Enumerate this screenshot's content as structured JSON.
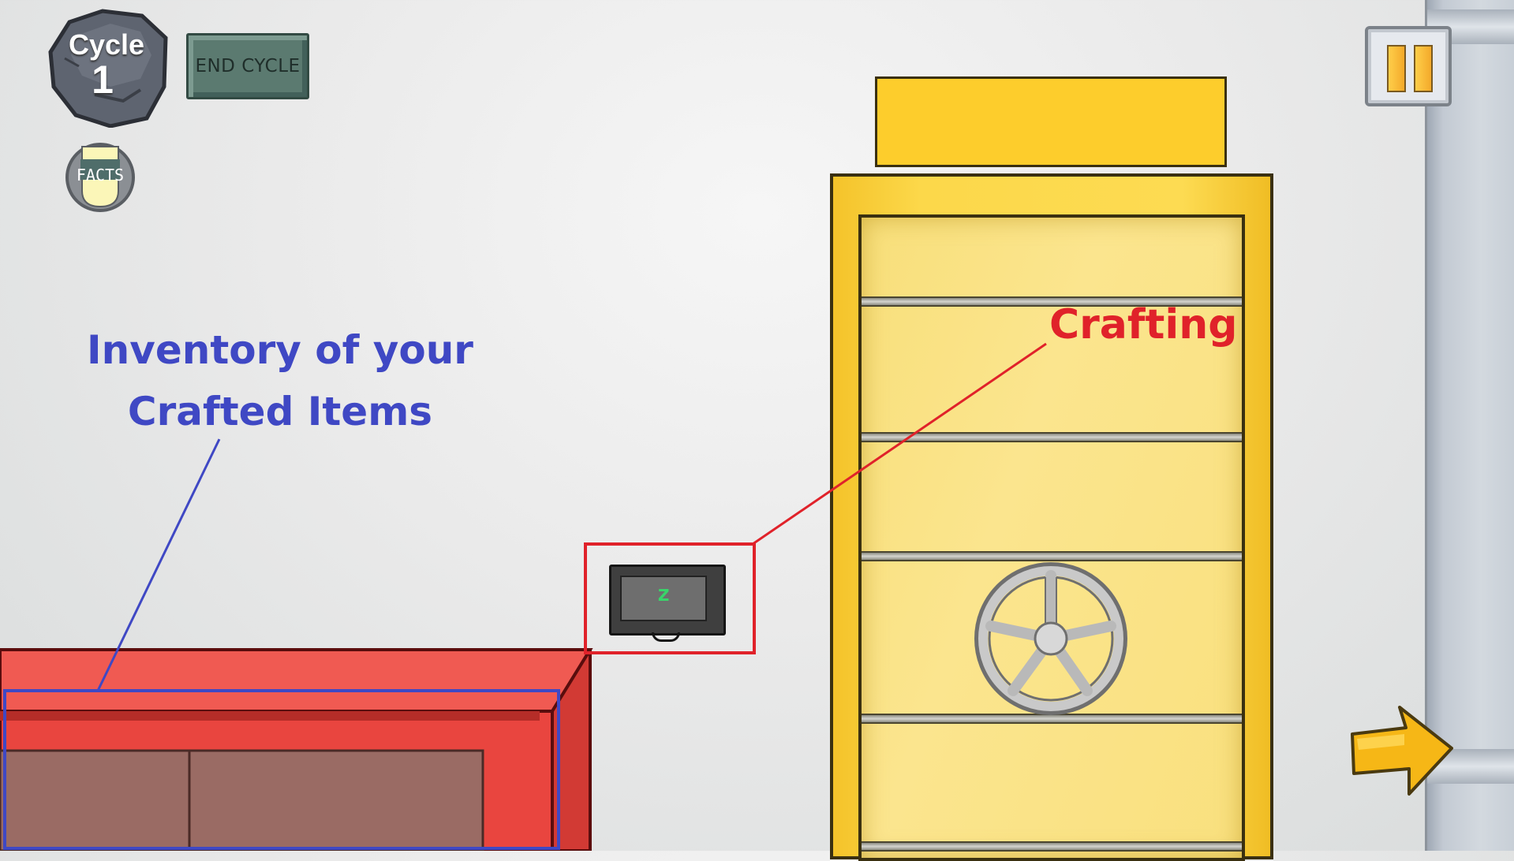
{
  "hud": {
    "cycle_title": "Cycle",
    "cycle_number": "1",
    "end_cycle_label": "END CYCLE",
    "facts_label": "FACTS"
  },
  "annotations": {
    "inventory_line1": "Inventory of your",
    "inventory_line2": "Crafted Items",
    "crafting": "Crafting"
  },
  "crafting_device": {
    "screen_text": "z"
  },
  "colors": {
    "inventory_annotation": "#3f48c4",
    "crafting_annotation": "#e0222a",
    "vault_yellow": "#fdcd2c",
    "counter_red": "#e9453f",
    "end_cycle_green": "#5b7a70"
  },
  "icons": {
    "cycle_badge": "rock-icon",
    "facts": "facts-jar-icon",
    "pause": "pause-icon",
    "vault_wheel": "vault-wheel-icon",
    "next": "arrow-right-icon"
  }
}
